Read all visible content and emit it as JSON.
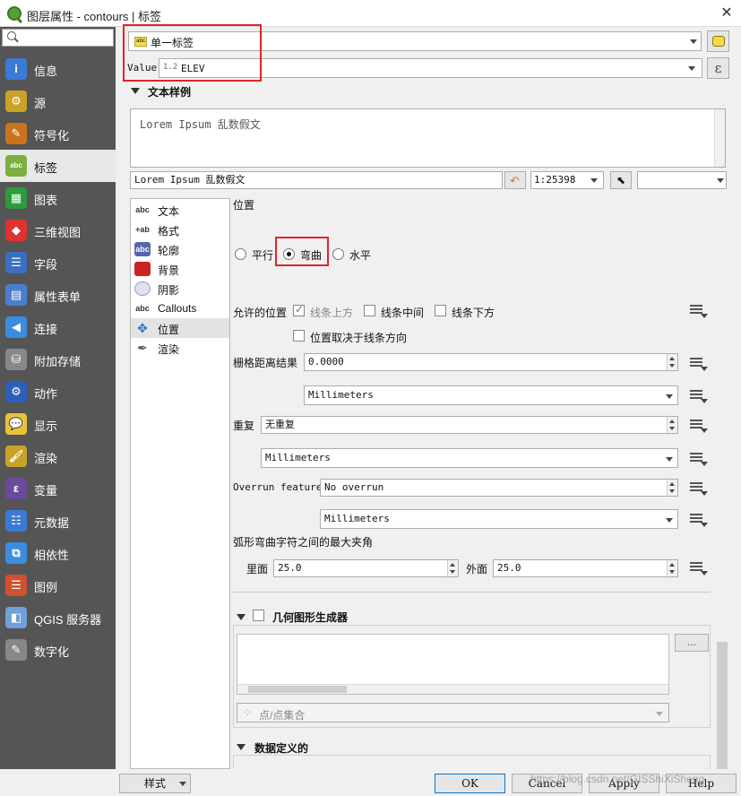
{
  "window": {
    "title": "图层属性 - contours | 标签"
  },
  "sidebar": {
    "search_placeholder": "",
    "items": [
      {
        "label": "信息",
        "icon": "info-icon"
      },
      {
        "label": "源",
        "icon": "source-icon"
      },
      {
        "label": "符号化",
        "icon": "symbology-icon"
      },
      {
        "label": "标签",
        "icon": "labels-icon"
      },
      {
        "label": "图表",
        "icon": "diagrams-icon"
      },
      {
        "label": "三维视图",
        "icon": "3d-view-icon"
      },
      {
        "label": "字段",
        "icon": "fields-icon"
      },
      {
        "label": "属性表单",
        "icon": "attributes-form-icon"
      },
      {
        "label": "连接",
        "icon": "joins-icon"
      },
      {
        "label": "附加存储",
        "icon": "auxiliary-storage-icon"
      },
      {
        "label": "动作",
        "icon": "actions-icon"
      },
      {
        "label": "显示",
        "icon": "display-icon"
      },
      {
        "label": "渲染",
        "icon": "rendering-icon"
      },
      {
        "label": "变量",
        "icon": "variables-icon"
      },
      {
        "label": "元数据",
        "icon": "metadata-icon"
      },
      {
        "label": "相依性",
        "icon": "dependencies-icon"
      },
      {
        "label": "图例",
        "icon": "legend-icon"
      },
      {
        "label": "QGIS 服务器",
        "icon": "qgis-server-icon"
      },
      {
        "label": "数字化",
        "icon": "digitizing-icon"
      }
    ],
    "active": "标签"
  },
  "labeling": {
    "mode": "单一标签",
    "mode_badge": "abc",
    "value_label": "Value",
    "value_type": "1.2",
    "value_field": "ELEV"
  },
  "text_sample": {
    "heading": "文本样例",
    "preview_text": "Lorem Ipsum 乱数假文",
    "input_text": "Lorem Ipsum 乱数假文",
    "scale": "1:25398"
  },
  "subnav": [
    {
      "label": "文本",
      "badge": "abc"
    },
    {
      "label": "格式",
      "badge": "+ab"
    },
    {
      "label": "轮廓",
      "badge": "abc"
    },
    {
      "label": "背景",
      "badge": ""
    },
    {
      "label": "阴影",
      "badge": ""
    },
    {
      "label": "Callouts",
      "badge": "abc"
    },
    {
      "label": "位置",
      "badge": ""
    },
    {
      "label": "渲染",
      "badge": ""
    }
  ],
  "placement": {
    "heading": "位置",
    "modes": [
      "平行",
      "弯曲",
      "水平"
    ],
    "selected_mode": "弯曲",
    "allowed_label": "允许的位置",
    "allowed": [
      {
        "label": "线条上方",
        "checked": true
      },
      {
        "label": "线条中间",
        "checked": false
      },
      {
        "label": "线条下方",
        "checked": false
      }
    ],
    "orientation": {
      "label": "位置取决于线条方向",
      "checked": false
    },
    "distance_label": "栅格距离结果",
    "distance_value": "0.0000",
    "distance_unit": "Millimeters",
    "repeat_label": "重复",
    "repeat_value": "无重复",
    "repeat_unit": "Millimeters",
    "overrun_label": "Overrun feature",
    "overrun_value": "No overrun",
    "overrun_unit": "Millimeters",
    "angle_heading": "弧形弯曲字符之间的最大夹角",
    "inside_label": "里面",
    "inside_value": "25.0",
    "outside_label": "外面",
    "outside_value": "25.0"
  },
  "geometry_generator": {
    "heading": "几何图形生成器",
    "ellipsis": "...",
    "geom_type": "点/点集合"
  },
  "data_defined": {
    "heading": "数据定义的"
  },
  "footer": {
    "style_button": "样式",
    "ok": "OK",
    "cancel": "Cancel",
    "apply": "Apply",
    "help": "Help",
    "watermark": "https://blog.csdn.net/GISShiXiSheng"
  }
}
